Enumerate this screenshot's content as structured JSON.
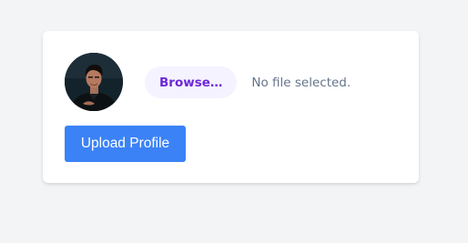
{
  "profile": {
    "avatar_alt": "profile-photo",
    "browse_label": "Browse…",
    "file_status": "No file selected.",
    "upload_label": "Upload Profile"
  },
  "colors": {
    "page_bg": "#f3f4f6",
    "card_bg": "#ffffff",
    "browse_bg": "#f5f3ff",
    "browse_text": "#6d28d9",
    "status_text": "#64748b",
    "upload_bg": "#3b82f6",
    "upload_text": "#ffffff"
  }
}
